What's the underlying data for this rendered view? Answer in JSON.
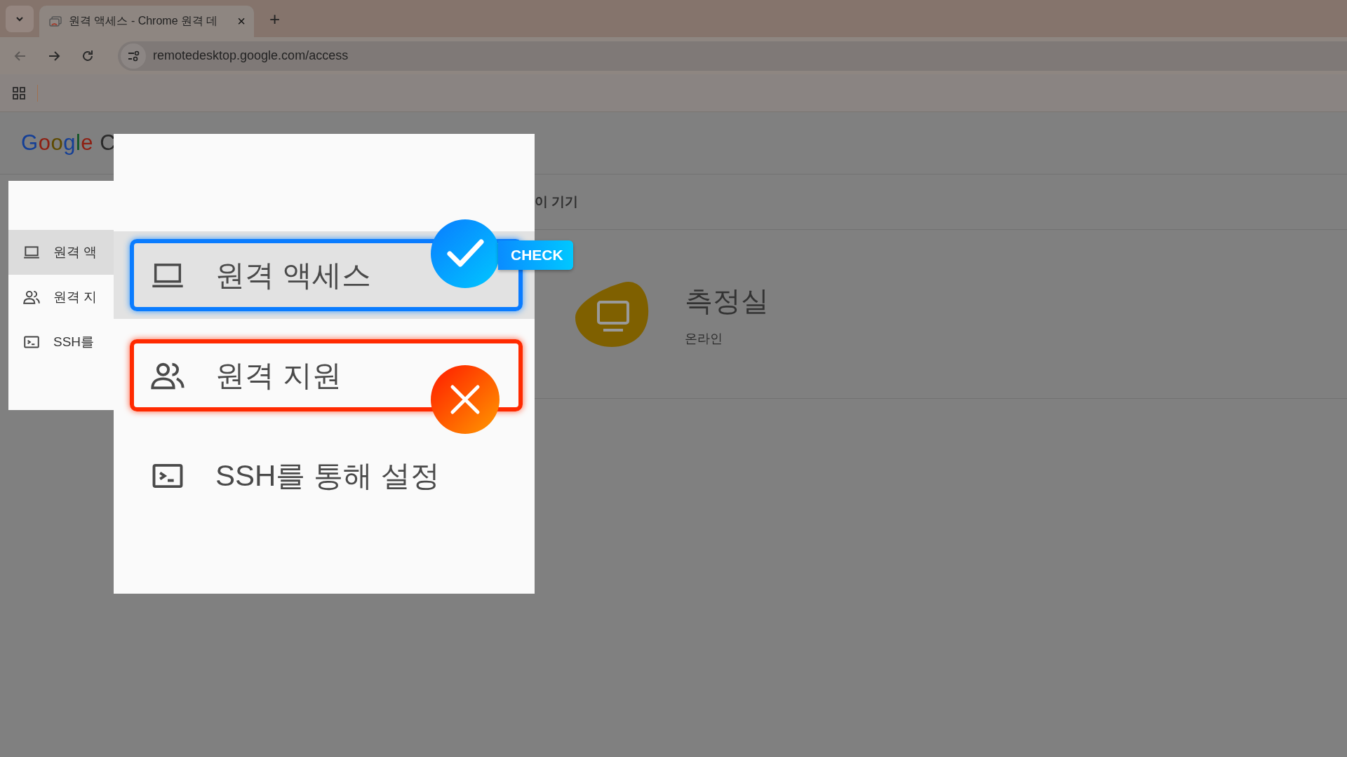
{
  "browser": {
    "tab_title": "원격 액세스 - Chrome 원격 데",
    "tab_close": "×",
    "new_tab": "+",
    "address": "remotedesktop.google.com/access"
  },
  "page": {
    "logo": "Google C",
    "section_tab": "이 기기",
    "device": {
      "name": "측정실",
      "status": "온라인"
    }
  },
  "sidebar_snippet": {
    "items": [
      {
        "label": "원격 액",
        "kind": "laptop",
        "selected": true
      },
      {
        "label": "원격 지",
        "kind": "people",
        "selected": false
      },
      {
        "label": "SSH를",
        "kind": "terminal",
        "selected": false
      }
    ]
  },
  "zoom_panel": {
    "items": [
      {
        "label": "원격 액세스",
        "kind": "laptop",
        "selected": true,
        "check_mark": true,
        "cross_mark": false
      },
      {
        "label": "원격 지원",
        "kind": "people",
        "selected": false,
        "check_mark": false,
        "cross_mark": true
      },
      {
        "label": "SSH를 통해 설정",
        "kind": "terminal",
        "selected": false,
        "check_mark": false,
        "cross_mark": false
      }
    ],
    "check_label": "CHECK"
  }
}
